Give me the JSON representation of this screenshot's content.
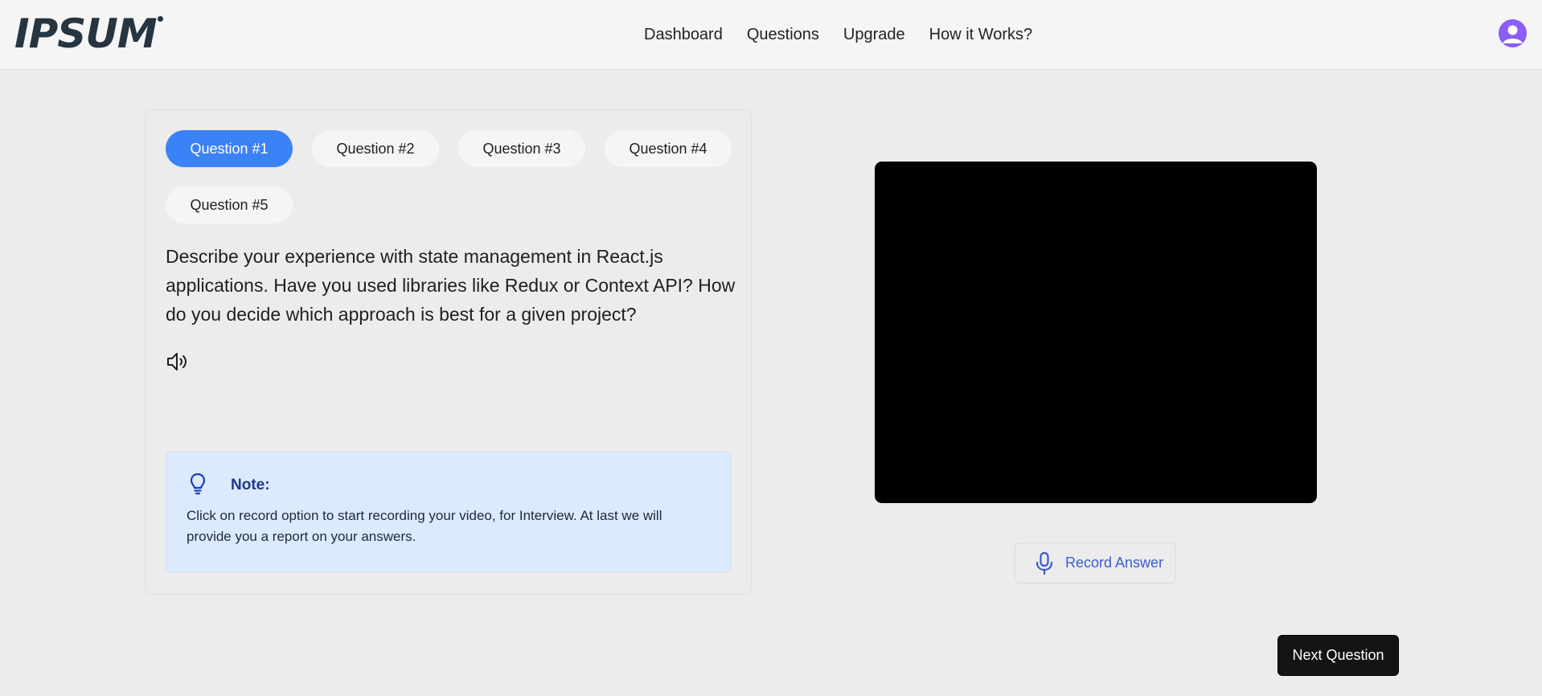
{
  "header": {
    "logo_text": "IPSUM",
    "nav": [
      {
        "label": "Dashboard"
      },
      {
        "label": "Questions"
      },
      {
        "label": "Upgrade"
      },
      {
        "label": "How it Works?"
      }
    ]
  },
  "questions": {
    "tabs": [
      {
        "label": "Question #1",
        "active": true
      },
      {
        "label": "Question #2",
        "active": false
      },
      {
        "label": "Question #3",
        "active": false
      },
      {
        "label": "Question #4",
        "active": false
      },
      {
        "label": "Question #5",
        "active": false
      }
    ],
    "current_text": "Describe your experience with state management in React.js applications. Have you used libraries like Redux or Context API? How do you decide which approach is best for a given project?"
  },
  "note": {
    "title": "Note:",
    "body": "Click on record option to start recording your video, for Interview. At last we will provide you a report on your answers."
  },
  "recorder": {
    "record_label": "Record Answer"
  },
  "footer": {
    "next_label": "Next Question"
  },
  "colors": {
    "accent": "#3b82f6",
    "note_bg": "#dbeafe",
    "avatar": "#8b5cf6"
  }
}
